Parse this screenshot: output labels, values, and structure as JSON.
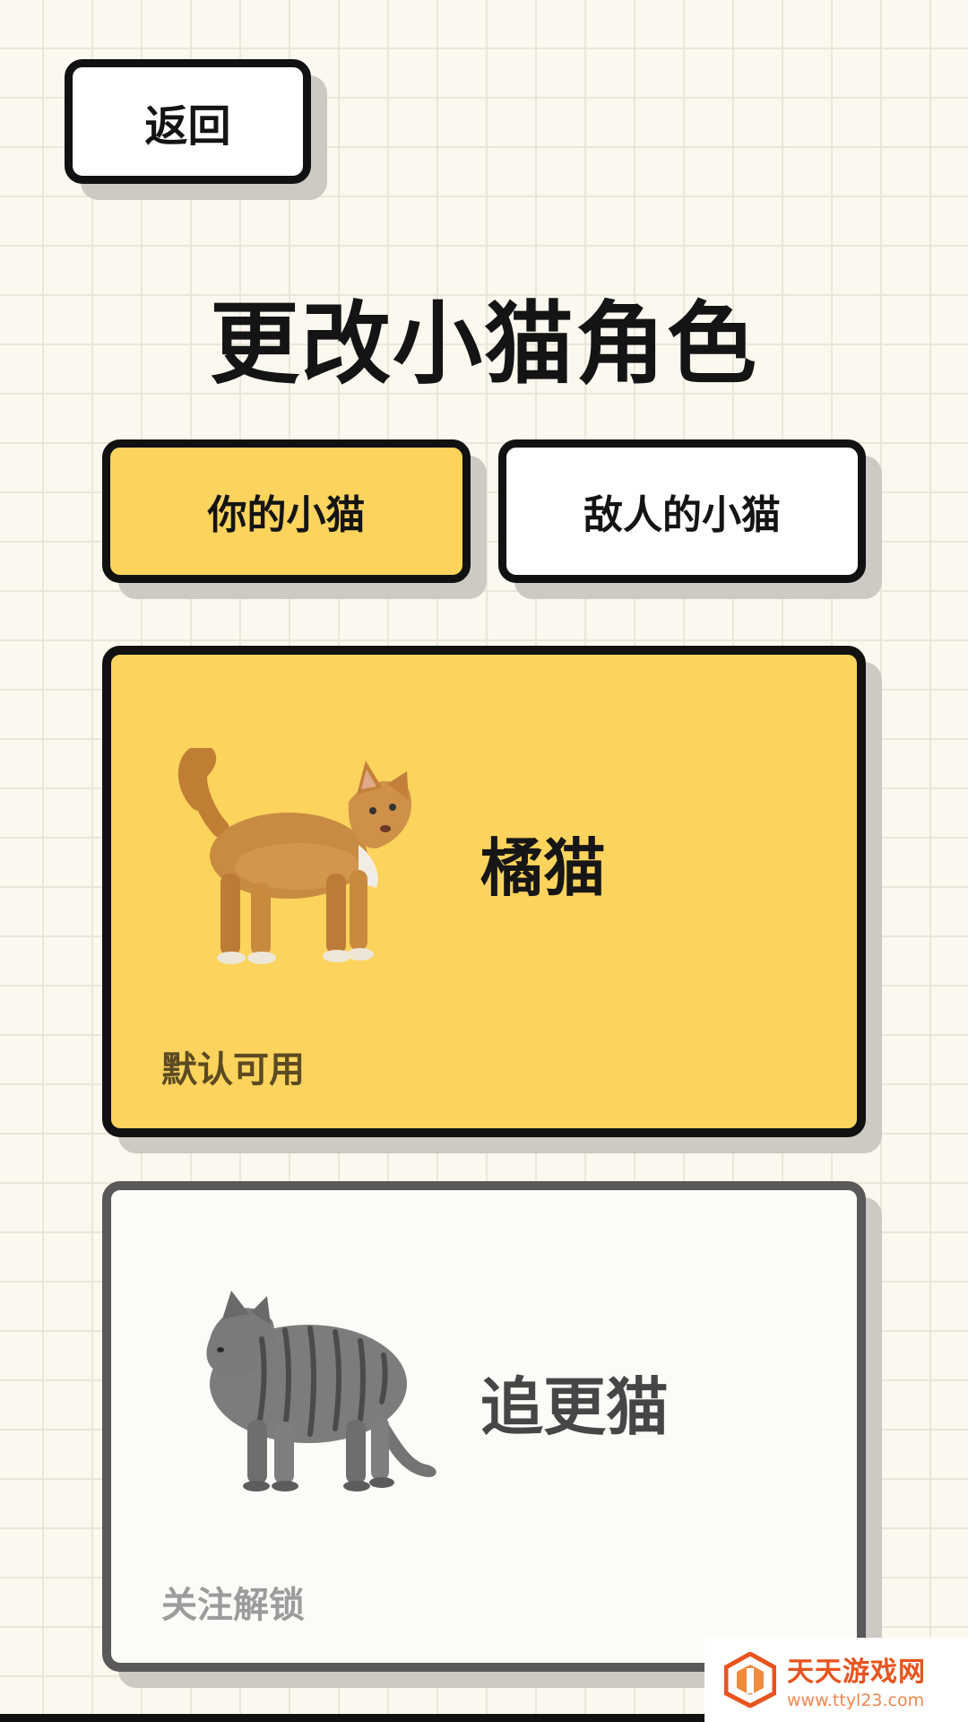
{
  "header": {
    "back_label": "返回",
    "title": "更改小猫角色"
  },
  "tabs": [
    {
      "label": "你的小猫",
      "selected": true
    },
    {
      "label": "敌人的小猫",
      "selected": false
    }
  ],
  "cats": [
    {
      "name": "橘猫",
      "status": "默认可用",
      "selected": true,
      "image": "orange-cat"
    },
    {
      "name": "追更猫",
      "status": "关注解锁",
      "selected": false,
      "image": "tabby-cat"
    }
  ],
  "watermark": {
    "title": "天天游戏网",
    "url": "www.ttyl23.com"
  },
  "colors": {
    "accent_yellow": "#fcd35c",
    "border": "#111111",
    "shadow": "#cdcac4",
    "background": "#fbf8ef"
  }
}
